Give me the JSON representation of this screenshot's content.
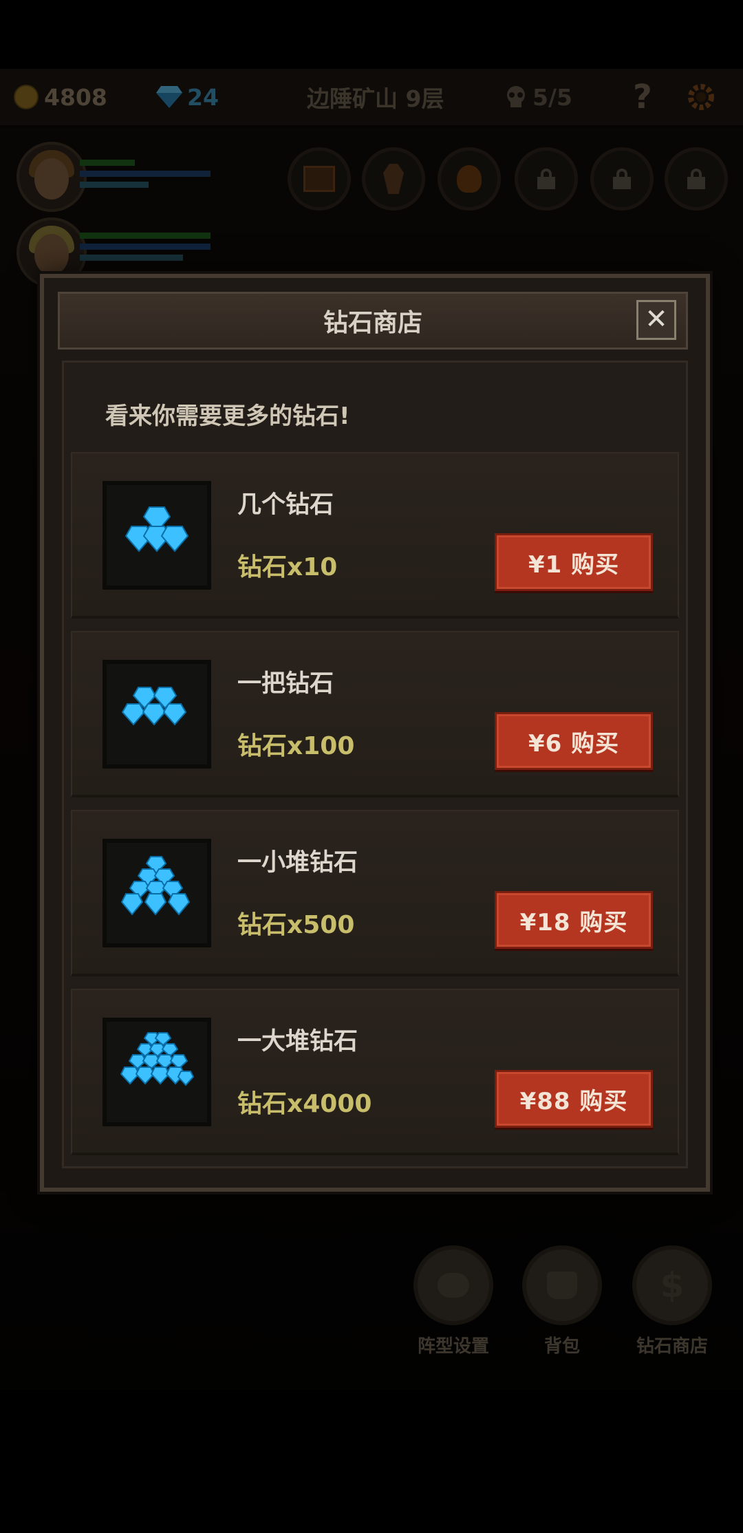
{
  "hud": {
    "coins": "4808",
    "gems": "24",
    "location": "边陲矿山 9层",
    "skull_count": "5/5",
    "help_label": "?",
    "settings_icon": "gear-icon"
  },
  "modal": {
    "title": "钻石商店",
    "close_label": "✕",
    "subtitle": "看来你需要更多的钻石!",
    "items": [
      {
        "name": "几个钻石",
        "count": "钻石x10",
        "price": "¥1 购买"
      },
      {
        "name": "一把钻石",
        "count": "钻石x100",
        "price": "¥6 购买"
      },
      {
        "name": "一小堆钻石",
        "count": "钻石x500",
        "price": "¥18 购买"
      },
      {
        "name": "一大堆钻石",
        "count": "钻石x4000",
        "price": "¥88 购买"
      }
    ]
  },
  "actions": [
    {
      "label": "阵型设置",
      "icon": "formation-icon"
    },
    {
      "label": "背包",
      "icon": "bag-icon"
    },
    {
      "label": "钻石商店",
      "icon": "dollar-icon"
    }
  ],
  "colors": {
    "buy_button": "#b43621",
    "gem_count_text": "#c7bd6a",
    "gem_blue": "#3cc0ff"
  }
}
